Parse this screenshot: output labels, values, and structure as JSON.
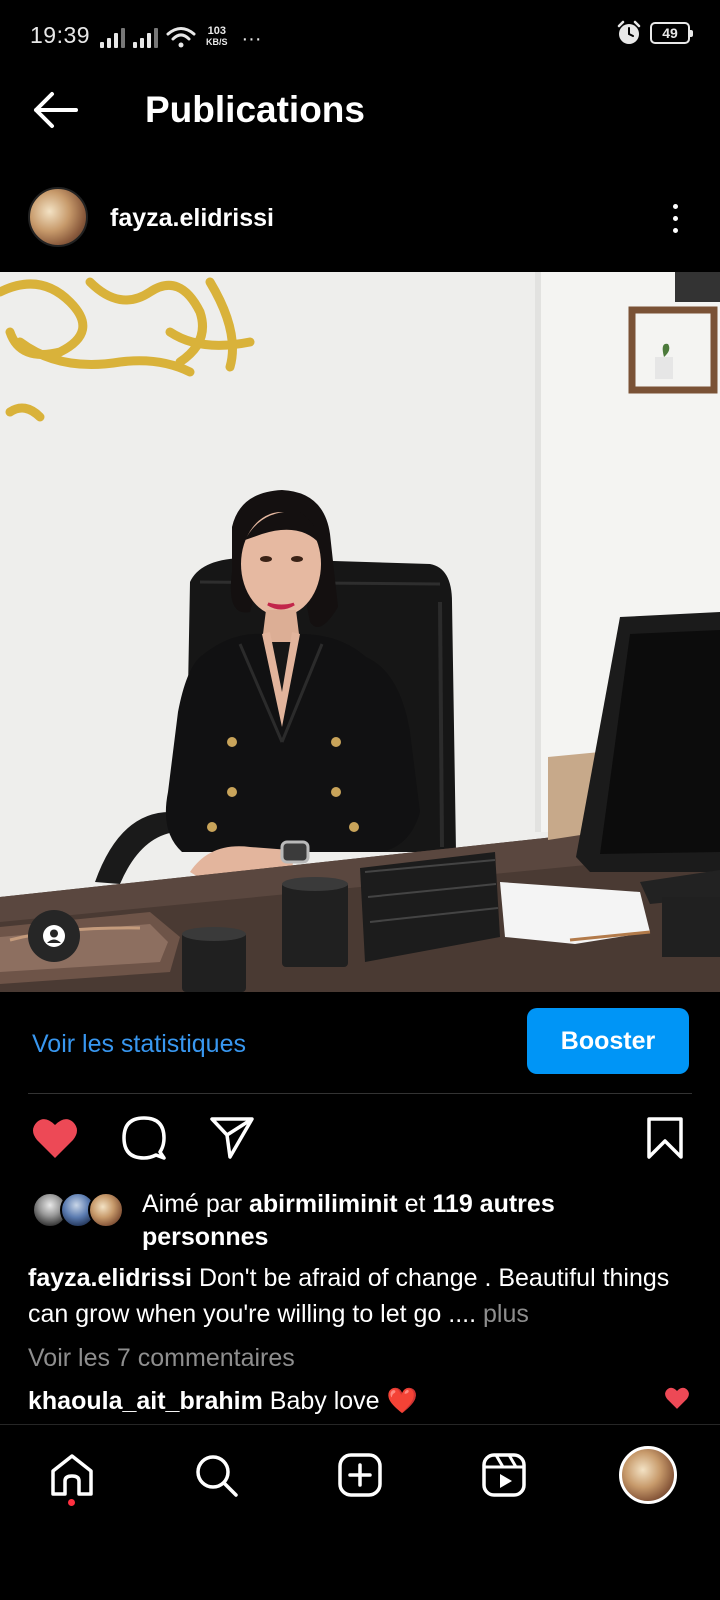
{
  "status_bar": {
    "time": "19:39",
    "speed_value": "103",
    "speed_unit": "KB/S",
    "more": "···",
    "battery": "49",
    "icons": [
      "signal-icon",
      "signal-icon",
      "wifi-icon",
      "alarm-icon",
      "battery-icon"
    ]
  },
  "header": {
    "back_icon": "arrow-left-icon",
    "title": "Publications"
  },
  "post": {
    "username": "fayza.elidrissi",
    "more_icon": "vertical-dots-icon",
    "stats_link": "Voir les statistiques",
    "boost_label": "Booster",
    "liked": true,
    "likes_prefix": "Aimé par",
    "likes_user": "abirmiliminit",
    "likes_and": "et",
    "likes_others": "119 autres personnes",
    "caption_user": "fayza.elidrissi",
    "caption_text": "Don't be afraid of change . Beautiful things can grow when you're willing to let go ....",
    "caption_more": "plus",
    "view_comments": "Voir les 7 commentaires",
    "comment_user": "khaoula_ait_brahim",
    "comment_text": "Baby love ❤️"
  },
  "colors": {
    "background": "#000000",
    "link_blue": "#3897f0",
    "boost_blue": "#0095f6",
    "like_red": "#ed4956",
    "muted": "#8e8e8e"
  },
  "bottom_nav": {
    "items": [
      "home-icon",
      "search-icon",
      "create-icon",
      "reels-icon",
      "profile-avatar"
    ],
    "active": "home-icon"
  }
}
